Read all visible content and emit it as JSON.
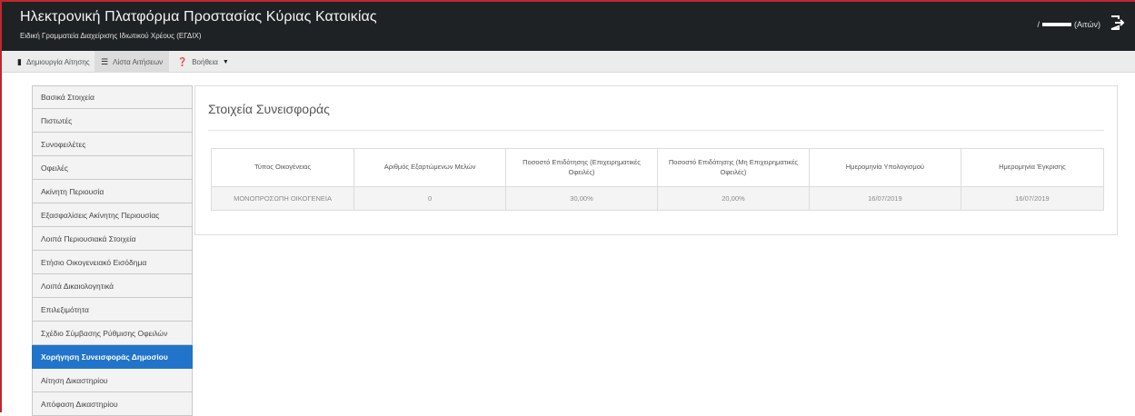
{
  "header": {
    "title": "Ηλεκτρονική Πλατφόρμα Προστασίας Κύριας Κατοικίας",
    "subtitle": "Ειδική Γραμματεία Διαχείρισης Ιδιωτικού Χρέους (ΕΓΔΙΧ)",
    "user_separator": "/",
    "user_role": "(Αιτών)",
    "logout_icon": "logout-icon"
  },
  "nav": {
    "items": [
      {
        "label": "Δημιουργία Αίτησης",
        "icon": "document-icon"
      },
      {
        "label": "Λίστα Αιτήσεων",
        "icon": "list-icon"
      },
      {
        "label": "Βοήθεια",
        "icon": "help-icon"
      }
    ]
  },
  "sidebar": {
    "items": [
      {
        "label": "Βασικά Στοιχεία"
      },
      {
        "label": "Πιστωτές"
      },
      {
        "label": "Συνοφειλέτες"
      },
      {
        "label": "Οφειλές"
      },
      {
        "label": "Ακίνητη Περιουσία"
      },
      {
        "label": "Εξασφαλίσεις Ακίνητης Περιουσίας"
      },
      {
        "label": "Λοιπά Περιουσιακά Στοιχεία"
      },
      {
        "label": "Ετήσιο Οικογενειακό Εισόδημα"
      },
      {
        "label": "Λοιπά Δικαιολογητικά"
      },
      {
        "label": "Επιλεξιμότητα"
      },
      {
        "label": "Σχέδιο Σύμβασης Ρύθμισης Οφειλών"
      },
      {
        "label": "Χορήγηση Συνεισφοράς Δημοσίου",
        "active": true
      },
      {
        "label": "Αίτηση Δικαστηρίου"
      },
      {
        "label": "Απόφαση Δικαστηρίου"
      }
    ]
  },
  "main": {
    "heading": "Στοιχεία Συνεισφοράς",
    "table": {
      "headers": [
        "Τύπος Οικογένειας",
        "Αριθμός Εξαρτώμενων Μελών",
        "Ποσοστό Επιδότησης (Επιχειρηματικές Οφειλές)",
        "Ποσοστό Επιδότησης (Μη Επιχειρηματικές Οφειλές)",
        "Ημερομηνία Υπολογισμού",
        "Ημερομηνία Έγκρισης"
      ],
      "rows": [
        [
          "ΜΟΝΟΠΡΟΣΩΠΗ ΟΙΚΟΓΕΝΕΙΑ",
          "0",
          "30,00%",
          "20,00%",
          "16/07/2019",
          "16/07/2019"
        ]
      ]
    }
  },
  "colors": {
    "header_bg": "#1f2224",
    "accent": "#2174c9",
    "frame_border": "#c0272d"
  }
}
